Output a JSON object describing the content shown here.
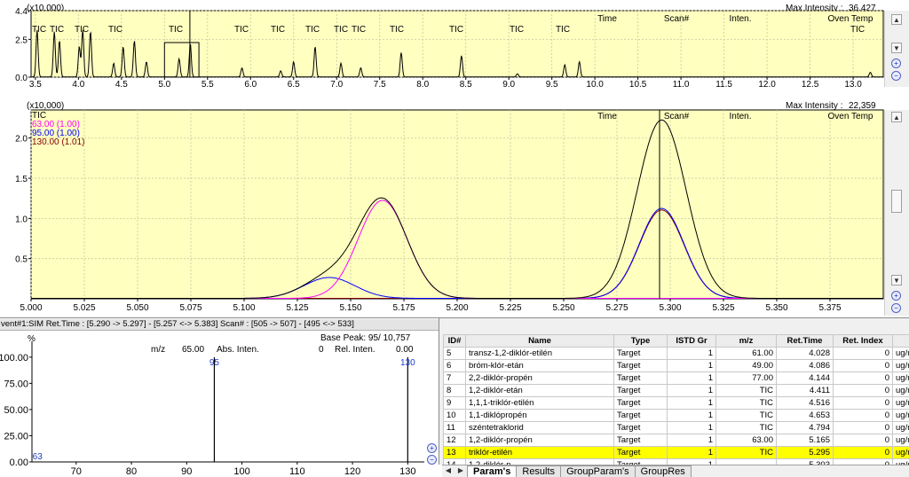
{
  "top_panel": {
    "scale_label": "(x10,000)",
    "max_intensity_label": "Max Intensity :",
    "max_intensity_value": "36,427",
    "header_cols": [
      "Time",
      "Scan#",
      "Inten.",
      "Oven Temp"
    ],
    "tic_labels": [
      "TIC",
      "TIC",
      "TIC",
      "TIC",
      "TIC",
      "TIC",
      "TIC",
      "TIC",
      "TIC",
      "TIC",
      "TIC",
      "TIC",
      "TIC",
      "TIC",
      "TIC",
      "TIC"
    ],
    "tic_label_last": "TIC"
  },
  "mid_panel": {
    "scale_label": "(x10,000)",
    "max_intensity_label": "Max Intensity :",
    "max_intensity_value": "22,359",
    "header_cols": [
      "Time",
      "Scan#",
      "Inten.",
      "Oven Temp"
    ],
    "legend": [
      {
        "text": "TIC",
        "color": "#000000"
      },
      {
        "text": "63.00 (1.00)",
        "color": "#ff00ff"
      },
      {
        "text": "95.00 (1.00)",
        "color": "#0000ff"
      },
      {
        "text": "130.00 (1.01)",
        "color": "#800000"
      }
    ]
  },
  "spectrum_panel": {
    "header": "vent#1:SIM   Ret.Time : [5.290 -> 5.297] - [5.257 <-> 5.383]   Scan# : [505 -> 507] - [495 <-> 533]",
    "base_peak": "Base Peak: 95/ 10,757",
    "percent_label": "%",
    "mz_label": "m/z",
    "mz_value": "65.00",
    "abs_label": "Abs. Inten.",
    "abs_value": "0",
    "rel_label": "Rel. Inten.",
    "rel_value": "0.00"
  },
  "table": {
    "headers": [
      "ID#",
      "Name",
      "Type",
      "ISTD Gr",
      "m/z",
      "Ret.Time",
      "Ret. Index",
      ""
    ],
    "rows": [
      {
        "id": "5",
        "name": "transz-1,2-diklór-etilén",
        "type": "Target",
        "istd": "1",
        "mz": "61.00",
        "rt": "4.028",
        "ri": "0",
        "unit": "ug/m"
      },
      {
        "id": "6",
        "name": "bróm-klór-etán",
        "type": "Target",
        "istd": "1",
        "mz": "49.00",
        "rt": "4.086",
        "ri": "0",
        "unit": "ug/m"
      },
      {
        "id": "7",
        "name": "2,2-diklór-propén",
        "type": "Target",
        "istd": "1",
        "mz": "77.00",
        "rt": "4.144",
        "ri": "0",
        "unit": "ug/m"
      },
      {
        "id": "8",
        "name": "1,2-diklór-etán",
        "type": "Target",
        "istd": "1",
        "mz": "TIC",
        "rt": "4.411",
        "ri": "0",
        "unit": "ug/m"
      },
      {
        "id": "9",
        "name": "1,1,1-triklór-etilén",
        "type": "Target",
        "istd": "1",
        "mz": "TIC",
        "rt": "4.516",
        "ri": "0",
        "unit": "ug/m"
      },
      {
        "id": "10",
        "name": "1,1-diklópropén",
        "type": "Target",
        "istd": "1",
        "mz": "TIC",
        "rt": "4.653",
        "ri": "0",
        "unit": "ug/m"
      },
      {
        "id": "11",
        "name": "széntetraklorid",
        "type": "Target",
        "istd": "1",
        "mz": "TIC",
        "rt": "4.794",
        "ri": "0",
        "unit": "ug/m"
      },
      {
        "id": "12",
        "name": "1,2-diklór-propén",
        "type": "Target",
        "istd": "1",
        "mz": "63.00",
        "rt": "5.165",
        "ri": "0",
        "unit": "ug/m"
      },
      {
        "id": "13",
        "name": "triklór-etilén",
        "type": "Target",
        "istd": "1",
        "mz": "TIC",
        "rt": "5.295",
        "ri": "0",
        "unit": "ug/m",
        "selected": true
      },
      {
        "id": "14",
        "name": "1,2-diklór-p...",
        "type": "Target",
        "istd": "1",
        "mz": "",
        "rt": "5.303",
        "ri": "0",
        "unit": "ug/m"
      }
    ]
  },
  "tabs": [
    "Param's",
    "Results",
    "GroupParam's",
    "GroupRes"
  ],
  "chart_data": [
    {
      "type": "line",
      "name": "TIC overview chromatogram",
      "xlim": [
        3.45,
        13.35
      ],
      "ylim": [
        0.0,
        4.4
      ],
      "x_ticks": [
        3.5,
        4.0,
        4.5,
        5.0,
        5.5,
        6.0,
        6.5,
        7.0,
        7.5,
        8.0,
        8.5,
        9.0,
        9.5,
        10.0,
        10.5,
        11.0,
        11.5,
        12.0,
        12.5,
        13.0
      ],
      "y_ticks": [
        0.0,
        2.5,
        4.4
      ],
      "y_tick_labels": [
        "0.0",
        "2.5",
        "4.4"
      ],
      "y_scale": "x10,000",
      "peaks": [
        {
          "rt": 3.52,
          "h": 3.1
        },
        {
          "rt": 3.72,
          "h": 3.0
        },
        {
          "rt": 3.78,
          "h": 2.4
        },
        {
          "rt": 4.01,
          "h": 2.0
        },
        {
          "rt": 4.05,
          "h": 3.1
        },
        {
          "rt": 4.14,
          "h": 3.0
        },
        {
          "rt": 4.41,
          "h": 0.9
        },
        {
          "rt": 4.52,
          "h": 2.0
        },
        {
          "rt": 4.65,
          "h": 2.4
        },
        {
          "rt": 4.79,
          "h": 1.0
        },
        {
          "rt": 5.17,
          "h": 1.2
        },
        {
          "rt": 5.3,
          "h": 2.2
        },
        {
          "rt": 5.9,
          "h": 0.6
        },
        {
          "rt": 6.35,
          "h": 0.4
        },
        {
          "rt": 6.5,
          "h": 1.0
        },
        {
          "rt": 6.75,
          "h": 2.0
        },
        {
          "rt": 7.05,
          "h": 0.9
        },
        {
          "rt": 7.28,
          "h": 0.6
        },
        {
          "rt": 7.75,
          "h": 1.6
        },
        {
          "rt": 8.45,
          "h": 1.4
        },
        {
          "rt": 9.1,
          "h": 0.2
        },
        {
          "rt": 9.65,
          "h": 0.8
        },
        {
          "rt": 9.82,
          "h": 1.0
        },
        {
          "rt": 13.2,
          "h": 0.3
        }
      ],
      "cursor_x": 5.295,
      "zoom_box": [
        5.0,
        5.4
      ]
    },
    {
      "type": "line",
      "name": "zoomed chromatogram",
      "xlim": [
        5.0,
        5.4
      ],
      "ylim": [
        0.0,
        2.35
      ],
      "x_ticks": [
        5.0,
        5.025,
        5.05,
        5.075,
        5.1,
        5.125,
        5.15,
        5.175,
        5.2,
        5.225,
        5.25,
        5.275,
        5.3,
        5.325,
        5.35,
        5.375
      ],
      "y_ticks": [
        0.5,
        1.0,
        1.5,
        2.0
      ],
      "y_scale": "x10,000",
      "cursor_x": 5.295,
      "series": [
        {
          "name": "TIC",
          "color": "#000000",
          "peaks": [
            {
              "rt": 5.14,
              "h": 0.26,
              "w": 0.012
            },
            {
              "rt": 5.165,
              "h": 1.22,
              "w": 0.0115
            },
            {
              "rt": 5.296,
              "h": 2.22,
              "w": 0.0115
            }
          ]
        },
        {
          "name": "63.00 (1.00)",
          "color": "#ff00ff",
          "peaks": [
            {
              "rt": 5.165,
              "h": 1.22,
              "w": 0.0115
            }
          ]
        },
        {
          "name": "95.00 (1.00)",
          "color": "#0000ff",
          "peaks": [
            {
              "rt": 5.14,
              "h": 0.26,
              "w": 0.012
            },
            {
              "rt": 5.296,
              "h": 1.12,
              "w": 0.0105
            }
          ]
        },
        {
          "name": "130.00 (1.01)",
          "color": "#800000",
          "peaks": [
            {
              "rt": 5.296,
              "h": 1.1,
              "w": 0.0105
            }
          ]
        }
      ]
    },
    {
      "type": "bar",
      "name": "mass spectrum",
      "xlim": [
        62,
        133
      ],
      "ylim": [
        0.0,
        110.0
      ],
      "x_ticks": [
        70,
        80,
        90,
        100,
        110,
        120,
        130
      ],
      "y_ticks": [
        0.0,
        25.0,
        50.0,
        75.0,
        100.0
      ],
      "y_tick_labels": [
        "0.00",
        "25.00",
        "50.00",
        "75.00",
        "100.00"
      ],
      "bars": [
        {
          "mz": 63,
          "rel": 0.0
        },
        {
          "mz": 95,
          "rel": 100.0
        },
        {
          "mz": 130,
          "rel": 100.0
        }
      ]
    }
  ]
}
